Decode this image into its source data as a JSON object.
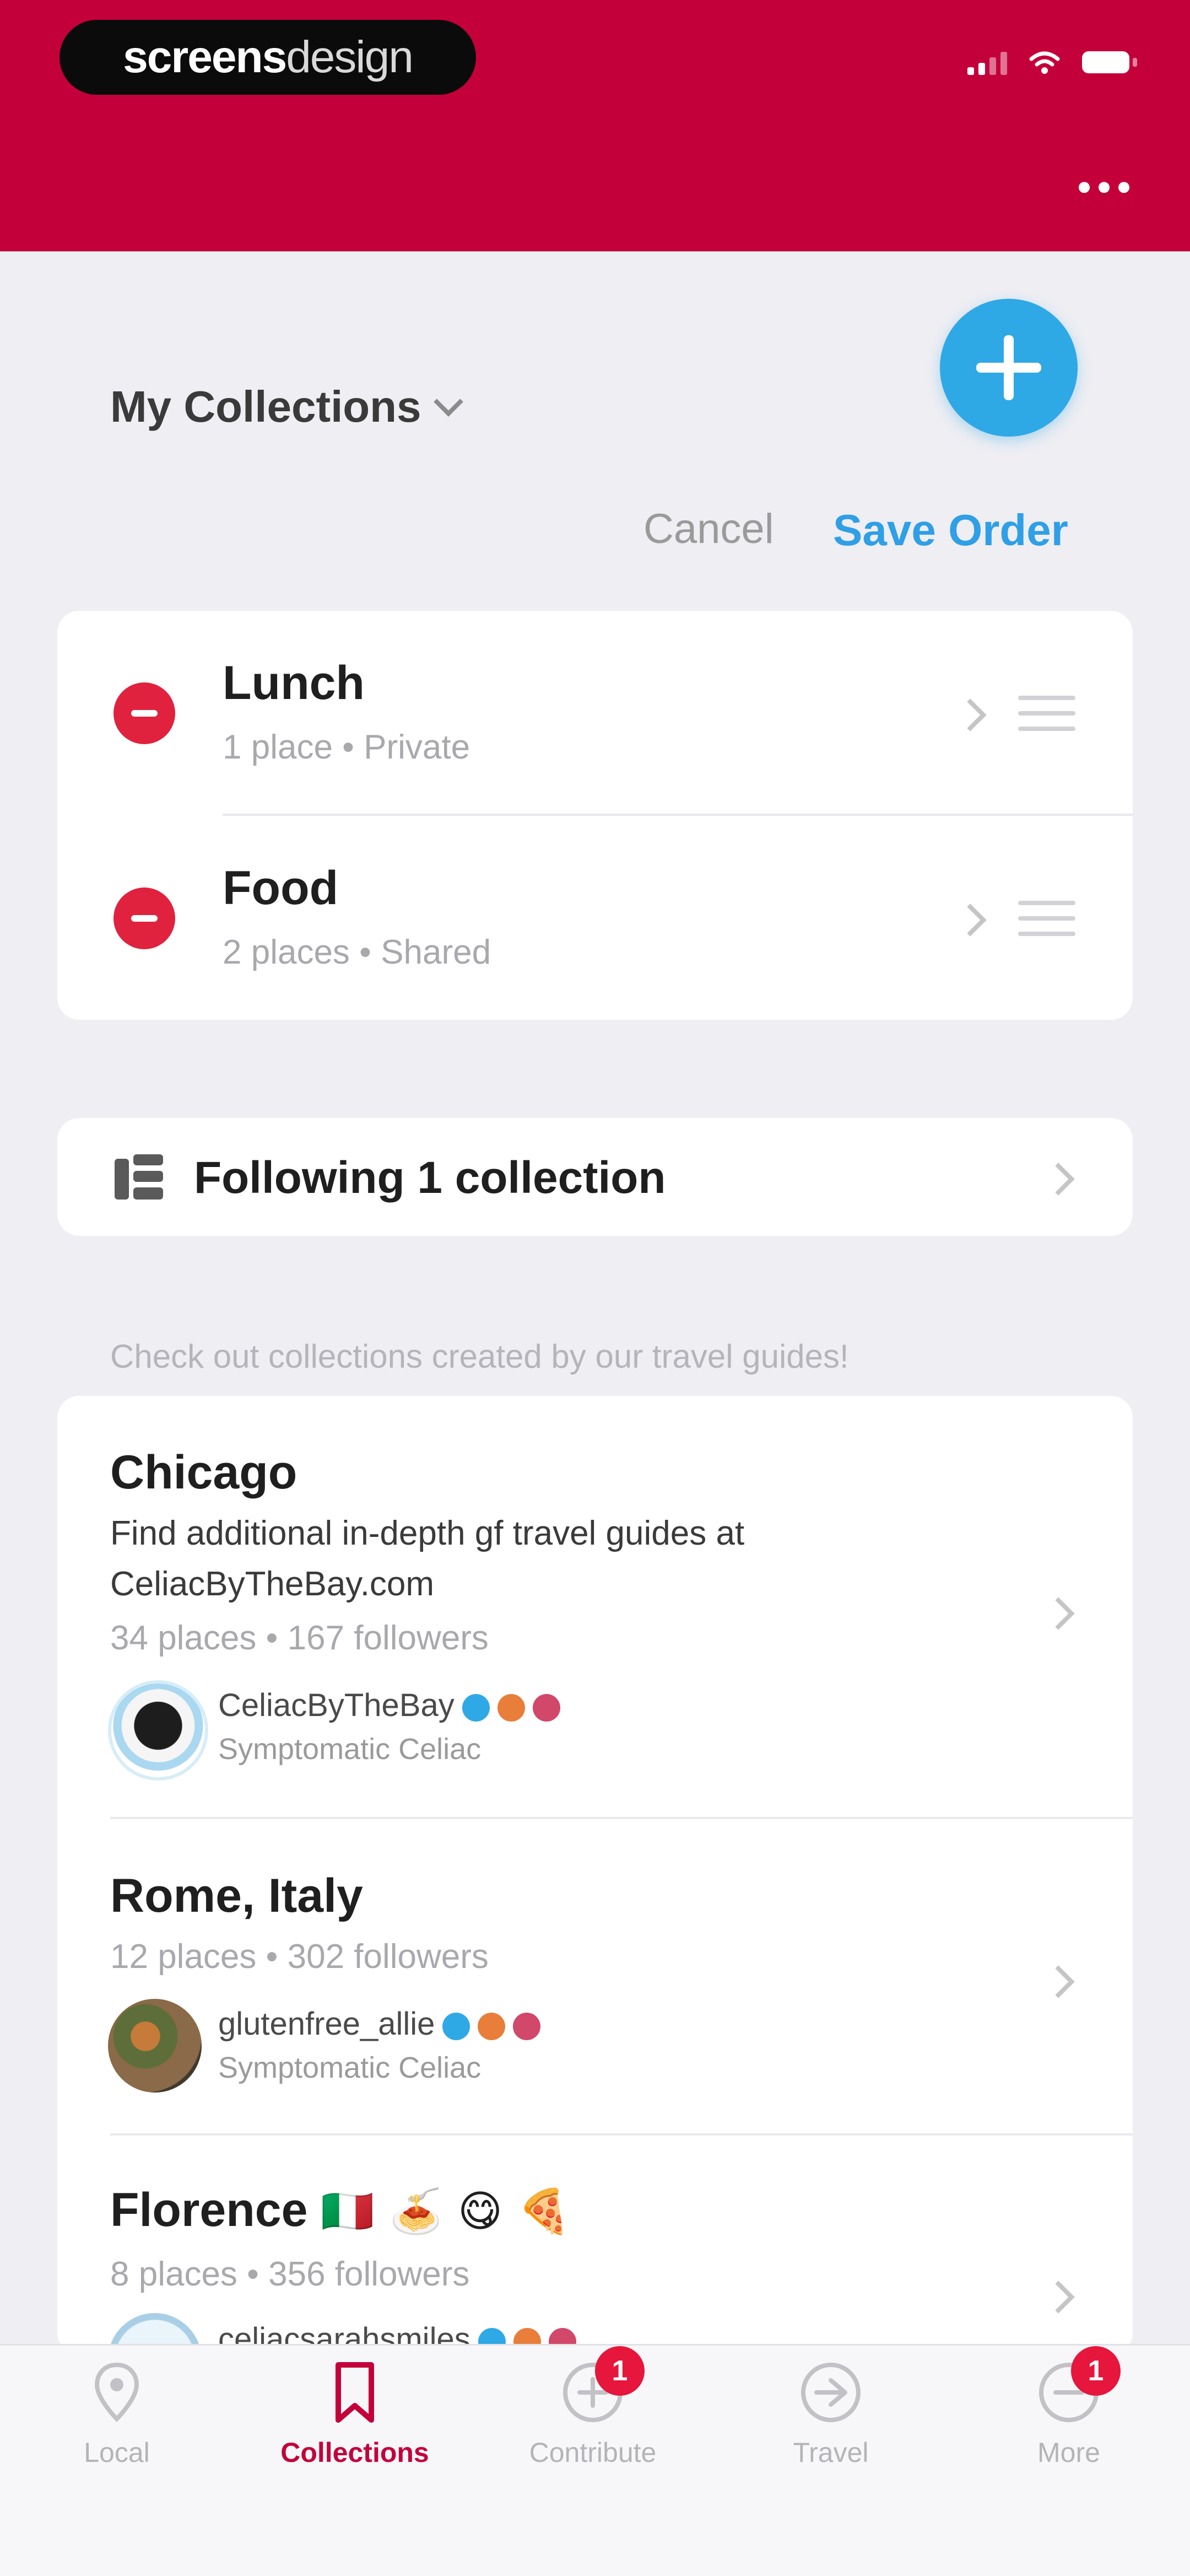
{
  "brand": {
    "part1": "screens",
    "part2": "design"
  },
  "colors": {
    "primary": "#C4003A",
    "accent": "#2FA8E6",
    "danger": "#E0223F"
  },
  "header": {
    "more_icon": "more-horizontal-icon",
    "title": "My Collections"
  },
  "actions": {
    "cancel_label": "Cancel",
    "save_label": "Save Order",
    "add_icon": "plus-icon"
  },
  "my_collections": [
    {
      "title": "Lunch",
      "count": "1 place",
      "visibility": "Private"
    },
    {
      "title": "Food",
      "count": "2 places",
      "visibility": "Shared"
    }
  ],
  "separator": "•",
  "following": {
    "label": "Following 1 collection",
    "icon": "collection-stack-icon"
  },
  "guides_hint": "Check out collections created by our travel guides!",
  "guides": [
    {
      "title": "Chicago",
      "description_line1": "Find additional in-depth gf travel guides at",
      "description_line2": "CeliacByTheBay.com",
      "places": "34 places",
      "followers": "167 followers",
      "author": "CeliacByTheBay",
      "author_type": "Symptomatic Celiac"
    },
    {
      "title": "Rome, Italy",
      "places": "12 places",
      "followers": "302 followers",
      "author": "glutenfree_allie",
      "author_type": "Symptomatic Celiac"
    },
    {
      "title": "Florence",
      "title_emoji": "🇮🇹 🍝 😋 🍕",
      "places": "8 places",
      "followers": "356 followers",
      "author": "celiacsarahsmiles"
    }
  ],
  "tabs": [
    {
      "label": "Local",
      "icon": "map-pin-icon"
    },
    {
      "label": "Collections",
      "icon": "bookmark-icon",
      "active": true
    },
    {
      "label": "Contribute",
      "icon": "plus-circle-icon",
      "badge": "1"
    },
    {
      "label": "Travel",
      "icon": "airplane-icon"
    },
    {
      "label": "More",
      "icon": "more-circle-icon",
      "badge": "1"
    }
  ]
}
